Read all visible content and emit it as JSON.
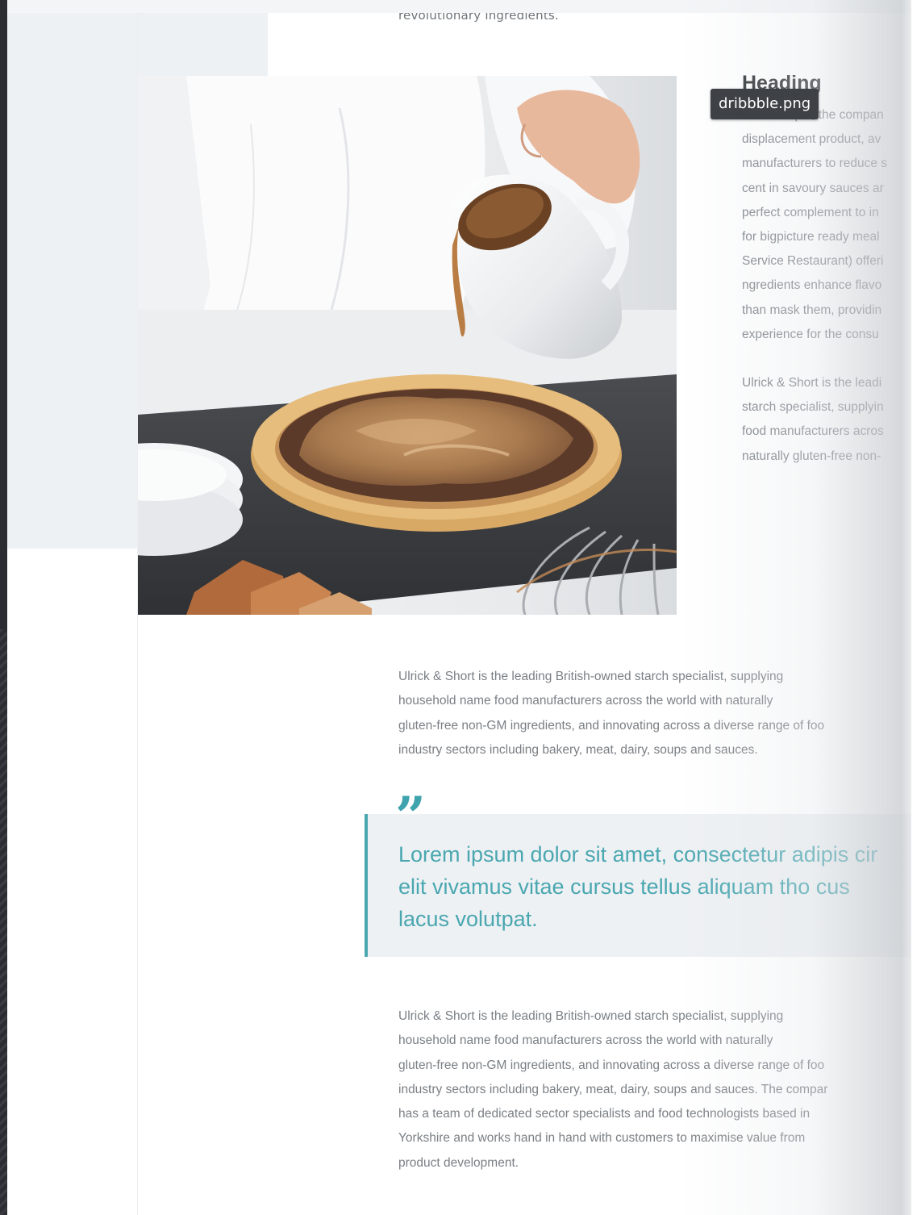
{
  "tooltip": {
    "filename": "dribbble.png"
  },
  "article": {
    "cut_line": "revolutionary ingredients.",
    "side": {
      "heading": "Heading",
      "para1_lines": [
        "For example, the compan",
        "displacement product, av",
        "manufacturers to reduce s",
        "cent in savoury sauces ar",
        "perfect complement to in",
        "for bigpicture ready meal",
        "Service Restaurant) offeri",
        "ngredients enhance flavo",
        "than mask them, providin",
        "experience for the consu"
      ],
      "para2_lines": [
        "Ulrick & Short is the leadi",
        "starch specialist, supplyin",
        "food manufacturers acros",
        "naturally gluten-free non-"
      ]
    },
    "para1_lines": [
      "Ulrick & Short is the leading British-owned starch specialist, supplying",
      "household name food manufacturers across the world with naturally",
      "gluten-free non-GM ingredients, and innovating across a diverse range of foo",
      "industry sectors including bakery, meat, dairy, soups and sauces."
    ],
    "quote": {
      "mark": "”",
      "lines": [
        "Lorem ipsum dolor sit amet, consectetur adipis cir",
        "elit vivamus vitae cursus tellus aliquam tho cus",
        "lacus volutpat."
      ]
    },
    "para2_lines": [
      "Ulrick & Short is the leading British-owned starch specialist, supplying",
      "household name food manufacturers across the world with naturally",
      "gluten-free non-GM ingredients, and innovating across a diverse range of foo",
      "industry sectors including bakery, meat, dairy, soups and sauces. The compar",
      "has a team of dedicated sector specialists and food technologists based in",
      "Yorkshire and works hand in hand with customers to maximise value from",
      "product development."
    ]
  },
  "colors": {
    "accent": "#4aa7b0",
    "panel": "#eef1f4",
    "body_text": "#7a7f84",
    "heading": "#2b2e31",
    "tooltip_bg": "#3e4145"
  }
}
